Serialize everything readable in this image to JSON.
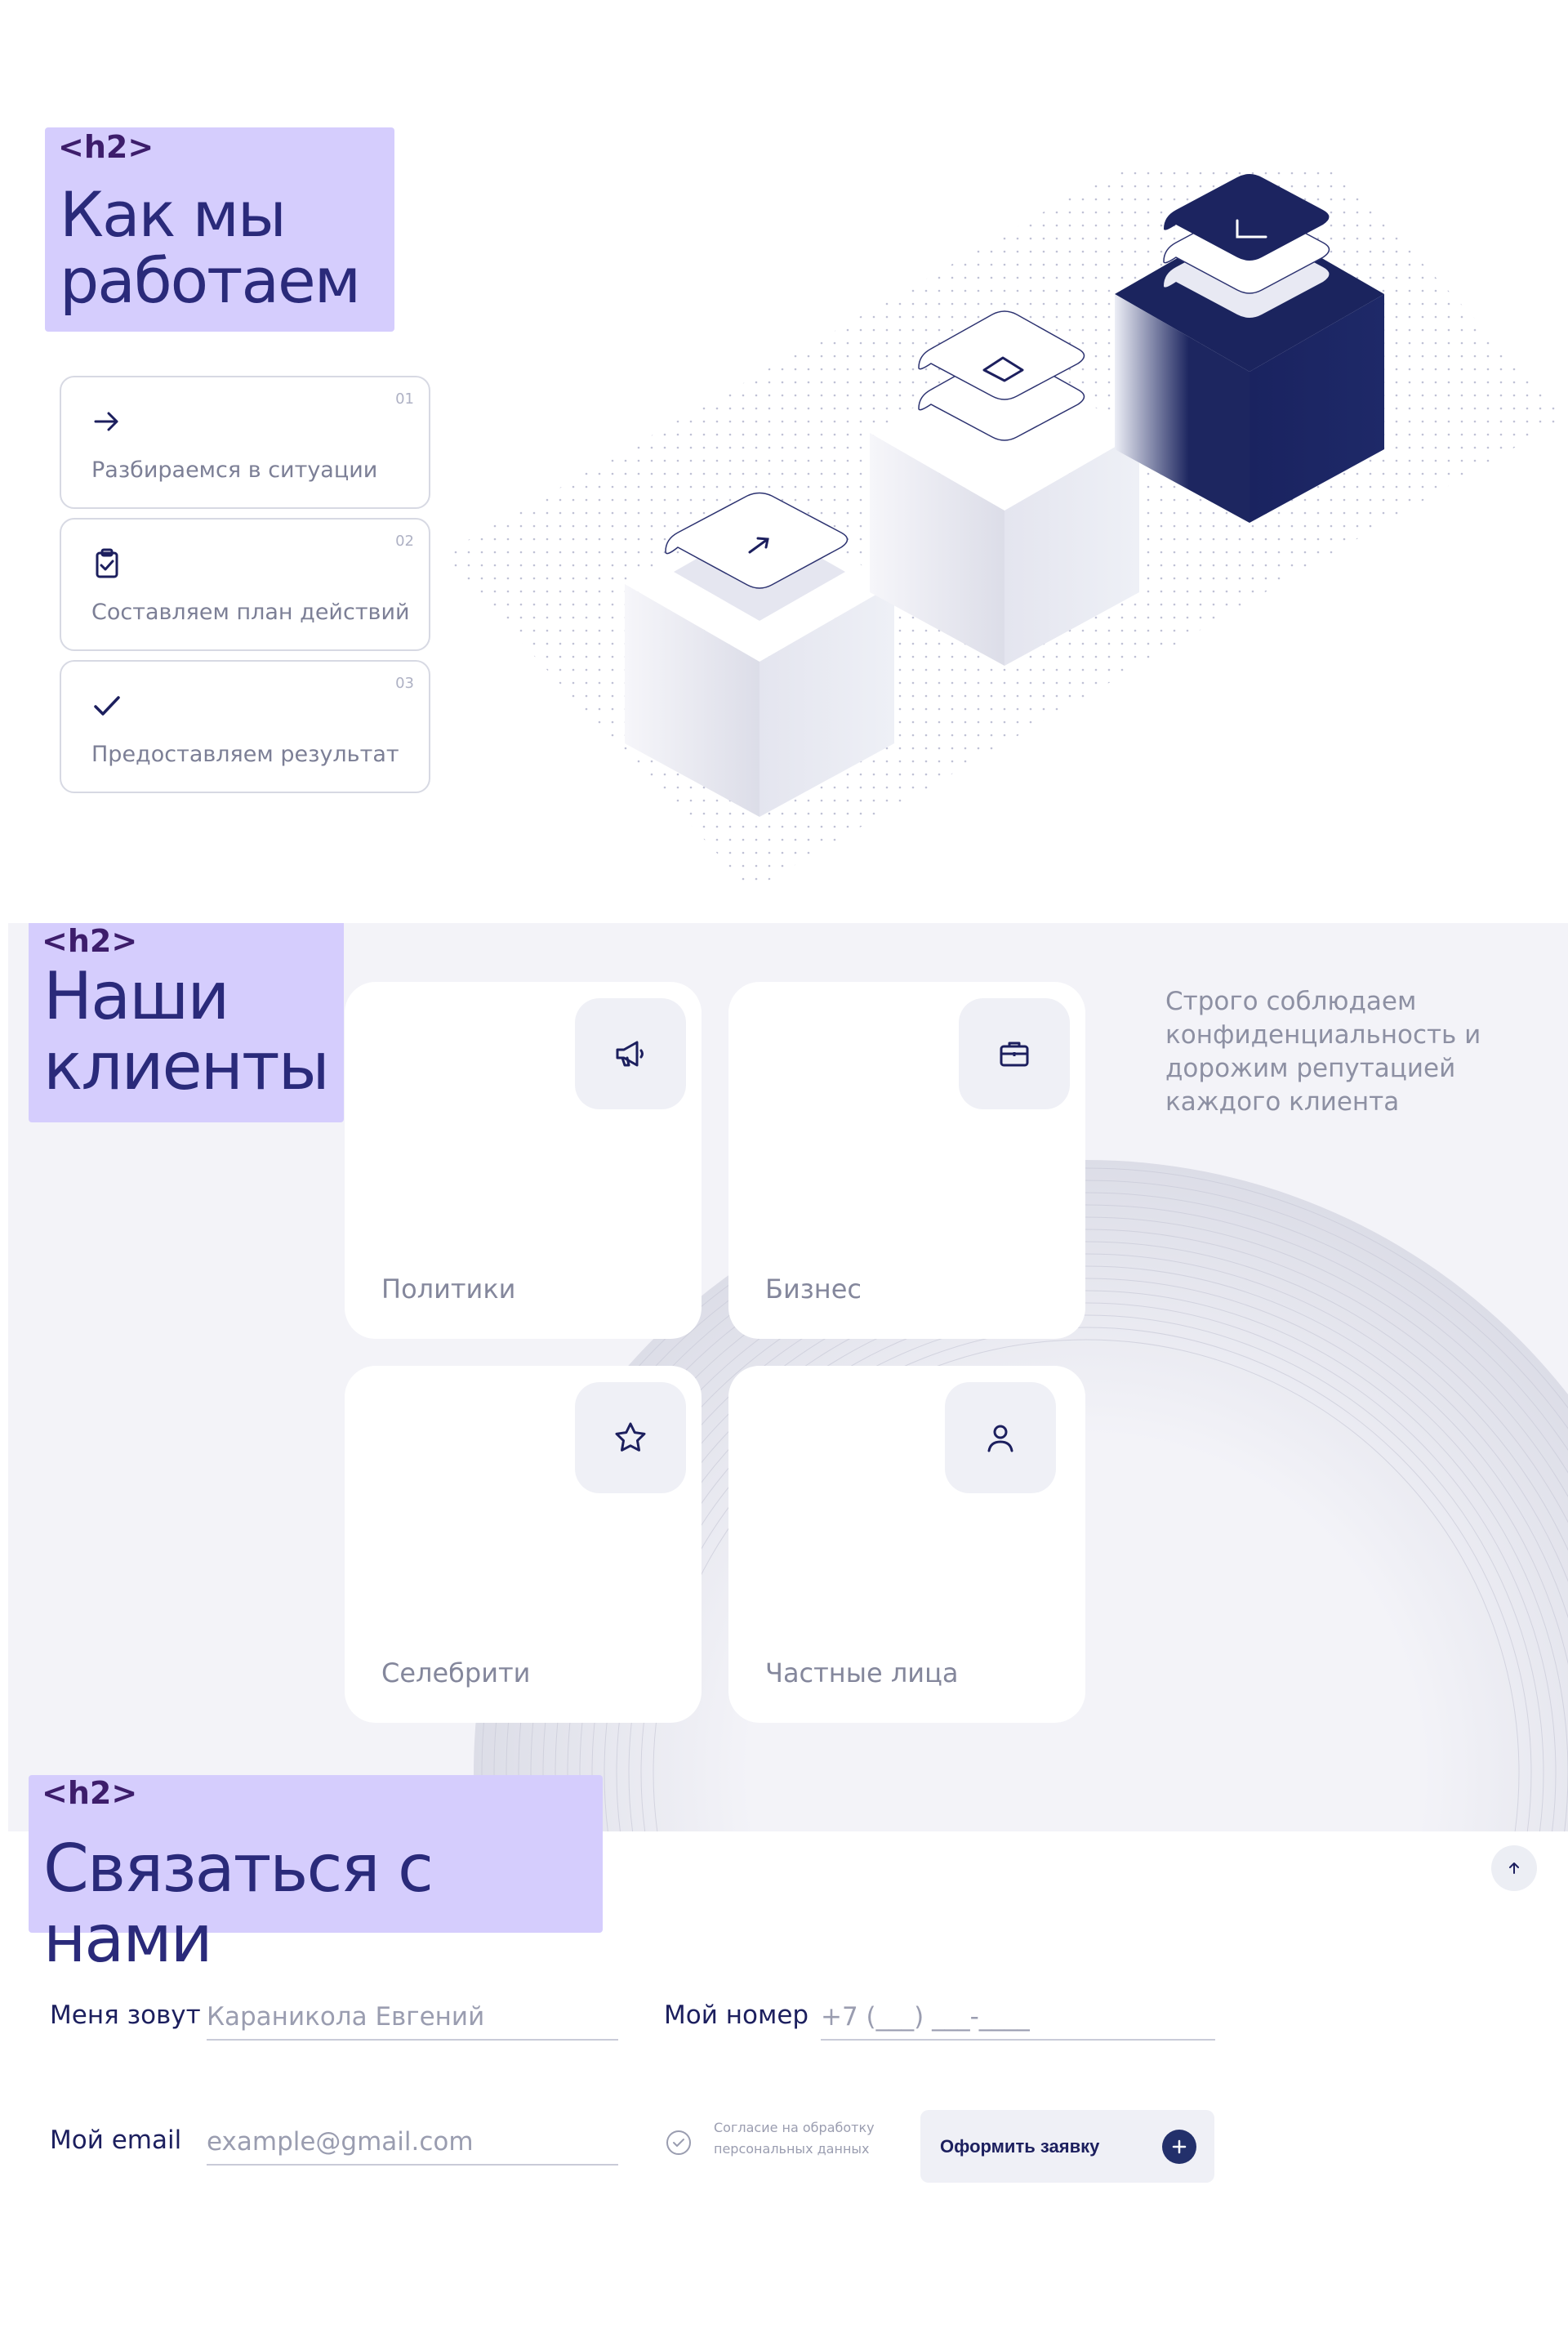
{
  "how_we_work": {
    "tag": "<h2>",
    "title": "Как мы работаем",
    "steps": [
      {
        "num": "01",
        "label": "Разбираемся в ситуации",
        "icon": "arrow-right-icon"
      },
      {
        "num": "02",
        "label": "Составляем план действий",
        "icon": "clipboard-check-icon"
      },
      {
        "num": "03",
        "label": "Предоставляем результат",
        "icon": "checkmark-icon"
      }
    ]
  },
  "clients": {
    "tag": "<h2>",
    "title": "Наши клиенты",
    "lede": "Строго соблюдаем конфиденциальность и дорожим репутацией каждого клиента",
    "cards": [
      {
        "label": "Политики",
        "icon": "megaphone-icon"
      },
      {
        "label": "Бизнес",
        "icon": "briefcase-icon"
      },
      {
        "label": "Селебрити",
        "icon": "star-icon"
      },
      {
        "label": "Частные лица",
        "icon": "user-icon"
      }
    ]
  },
  "contact": {
    "tag": "<h2>",
    "title": "Связаться с нами",
    "name_label": "Меня зовут",
    "name_placeholder": "Караникола Евгений",
    "phone_label": "Мой номер",
    "phone_placeholder": "+7 (___) ___-____",
    "email_label": "Мой email",
    "email_placeholder": "example@gmail.com",
    "consent": "Согласие на обработку персональных данных",
    "submit": "Оформить заявку"
  },
  "colors": {
    "accent": "#23306b",
    "tag_bg": "#d5cdfd",
    "title": "#2a2a7a"
  }
}
